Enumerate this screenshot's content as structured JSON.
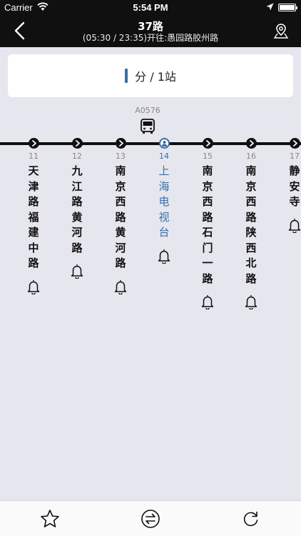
{
  "status_bar": {
    "carrier": "Carrier",
    "time": "5:54 PM",
    "icons": [
      "wifi-icon",
      "location-arrow-icon",
      "battery-icon"
    ]
  },
  "nav": {
    "title": "37路",
    "subtitle": "(05:30 / 23:35)开往:愚园路胶州路",
    "back_icon": "chevron-left-icon",
    "map_icon": "map-pin-icon"
  },
  "arrival": {
    "unit_text": "分 / 1站"
  },
  "bus": {
    "plate": "A0576"
  },
  "stops": [
    {
      "num": "11",
      "name": "天津路福建中路",
      "current": false
    },
    {
      "num": "12",
      "name": "九江路黄河路",
      "current": false
    },
    {
      "num": "13",
      "name": "南京西路黄河路",
      "current": false
    },
    {
      "num": "14",
      "name": "上海电视台",
      "current": true
    },
    {
      "num": "15",
      "name": "南京西路石门一路",
      "current": false
    },
    {
      "num": "16",
      "name": "南京西路陕西北路",
      "current": false
    },
    {
      "num": "17",
      "name": "静安寺",
      "current": false
    }
  ],
  "tabbar": {
    "items": [
      "star-icon",
      "swap-direction-icon",
      "refresh-icon"
    ]
  },
  "colors": {
    "bar": "#101010",
    "background": "#e6e6ee",
    "accent": "#3a6ea8"
  }
}
